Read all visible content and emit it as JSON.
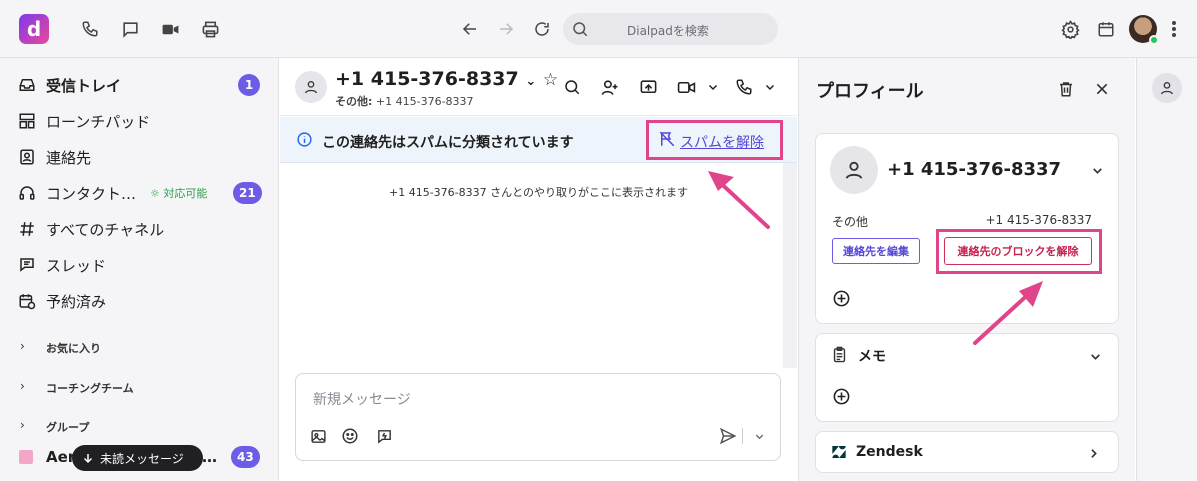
{
  "topbar": {
    "logo_letter": "d",
    "search_placeholder": "Dialpadを検索",
    "icons": [
      "phone-icon",
      "chat-icon",
      "video-icon",
      "printer-icon",
      "back-arrow-icon",
      "forward-arrow-icon",
      "refresh-icon",
      "search-icon",
      "settings-icon",
      "calendar-icon",
      "more-vertical-icon"
    ]
  },
  "sidebar": {
    "items": [
      {
        "label": "受信トレイ",
        "badge": "1",
        "icon": "inbox-icon",
        "bold": true
      },
      {
        "label": "ローンチパッド",
        "icon": "launchpad-icon"
      },
      {
        "label": "連絡先",
        "icon": "contacts-icon"
      },
      {
        "label": "コンタクト…",
        "status": "対応可能",
        "badge": "21",
        "icon": "headset-icon"
      },
      {
        "label": "すべてのチャネル",
        "icon": "hash-icon"
      },
      {
        "label": "スレッド",
        "icon": "thread-icon"
      },
      {
        "label": "予約済み",
        "icon": "scheduled-icon"
      }
    ],
    "sections": [
      {
        "label": "お気に入り"
      },
      {
        "label": "コーチングチーム"
      },
      {
        "label": "グループ"
      }
    ],
    "last_item": {
      "label": "Aer",
      "trailing": "…",
      "badge": "43"
    },
    "unread_pill": "未読メッセージ"
  },
  "conversation": {
    "contact_name": "+1 415-376-8337",
    "contact_sub_label": "その他:",
    "contact_sub_value": "+1 415-376-8337",
    "spam_banner": "この連絡先はスパムに分類されています",
    "unspam_link": "スパムを解除",
    "empty_message": "+1 415-376-8337 さんとのやり取りがここに表示されます",
    "composer_placeholder": "新規メッセージ"
  },
  "profile": {
    "title": "プロフィール",
    "name": "+1 415-376-8337",
    "type_label": "その他",
    "phone": "+1 415-376-8337",
    "edit_button": "連絡先を編集",
    "unblock_button": "連絡先のブロックを解除",
    "memo_title": "メモ",
    "integration_title": "Zendesk"
  },
  "colors": {
    "accent": "#6d5ce7",
    "highlight": "#e0458a",
    "zendesk": "#03363d"
  }
}
